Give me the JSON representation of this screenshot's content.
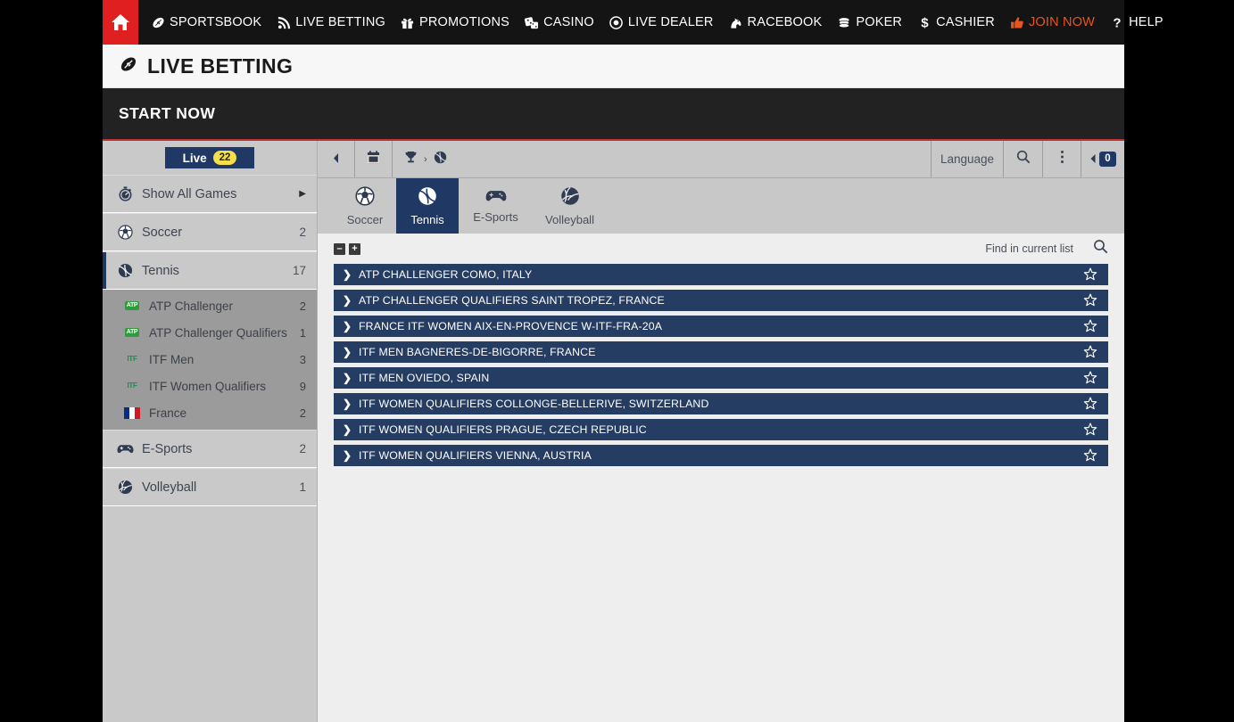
{
  "topnav": {
    "home_label": "Home",
    "items": [
      {
        "label": "SPORTSBOOK",
        "icon": "football-icon"
      },
      {
        "label": "LIVE BETTING",
        "icon": "signal-icon"
      },
      {
        "label": "PROMOTIONS",
        "icon": "gift-icon"
      },
      {
        "label": "CASINO",
        "icon": "dice-icon"
      },
      {
        "label": "LIVE DEALER",
        "icon": "target-icon"
      },
      {
        "label": "RACEBOOK",
        "icon": "horse-icon"
      },
      {
        "label": "POKER",
        "icon": "chips-icon"
      },
      {
        "label": "CASHIER",
        "icon": "dollar-icon"
      },
      {
        "label": "JOIN NOW",
        "icon": "thumbs-up-icon",
        "accent": "#e8541f"
      },
      {
        "label": "HELP",
        "icon": "question-icon"
      }
    ]
  },
  "page_header": {
    "title": "LIVE BETTING",
    "icon": "football-icon",
    "section_title": "START NOW"
  },
  "sidebar": {
    "live_label": "Live",
    "live_count": "22",
    "show_all": {
      "label": "Show All Games",
      "icon": "stopwatch-icon"
    },
    "sports": [
      {
        "label": "Soccer",
        "count": "2",
        "icon": "soccer-ball-icon",
        "active": false
      },
      {
        "label": "Tennis",
        "count": "17",
        "icon": "tennis-ball-icon",
        "active": true
      },
      {
        "label": "E-Sports",
        "count": "2",
        "icon": "gamepad-icon",
        "active": false
      },
      {
        "label": "Volleyball",
        "count": "1",
        "icon": "volleyball-icon",
        "active": false
      }
    ],
    "tennis_leagues": [
      {
        "label": "ATP Challenger",
        "count": "2",
        "icon": "atp-badge-icon"
      },
      {
        "label": "ATP Challenger Qualifiers",
        "count": "1",
        "icon": "atp-badge-icon"
      },
      {
        "label": "ITF Men",
        "count": "3",
        "icon": "itf-badge-icon"
      },
      {
        "label": "ITF Women Qualifiers",
        "count": "9",
        "icon": "itf-badge-icon"
      },
      {
        "label": "France",
        "count": "2",
        "icon": "france-flag-icon"
      }
    ]
  },
  "toolbar": {
    "back_icon": "caret-left-icon",
    "calendar_icon": "calendar-icon",
    "crumb_trophy_icon": "trophy-icon",
    "crumb_separator": "›",
    "crumb_sport_icon": "tennis-ball-icon",
    "language_label": "Language",
    "search_icon": "search-icon",
    "more_icon": "kebab-menu-icon",
    "betslip_icon": "caret-left-icon",
    "betslip_count": "0"
  },
  "sport_tabs": [
    {
      "label": "Soccer",
      "icon": "soccer-ball-icon",
      "active": false
    },
    {
      "label": "Tennis",
      "icon": "tennis-ball-icon",
      "active": true
    },
    {
      "label": "E-Sports",
      "icon": "gamepad-icon",
      "active": false
    },
    {
      "label": "Volleyball",
      "icon": "volleyball-icon",
      "active": false
    }
  ],
  "list_toolbar": {
    "collapse_all_label": "–",
    "expand_all_label": "+",
    "find_label": "Find in current list",
    "find_icon": "search-icon"
  },
  "tournaments": [
    {
      "name": "ATP CHALLENGER COMO, ITALY",
      "expand_icon": "chevron-right-icon",
      "favorite_icon": "star-outline-icon"
    },
    {
      "name": "ATP CHALLENGER QUALIFIERS SAINT TROPEZ, FRANCE",
      "expand_icon": "chevron-right-icon",
      "favorite_icon": "star-outline-icon"
    },
    {
      "name": "FRANCE ITF WOMEN AIX-EN-PROVENCE W-ITF-FRA-20A",
      "expand_icon": "chevron-right-icon",
      "favorite_icon": "star-outline-icon"
    },
    {
      "name": "ITF MEN BAGNERES-DE-BIGORRE, FRANCE",
      "expand_icon": "chevron-right-icon",
      "favorite_icon": "star-outline-icon"
    },
    {
      "name": "ITF MEN OVIEDO, SPAIN",
      "expand_icon": "chevron-right-icon",
      "favorite_icon": "star-outline-icon"
    },
    {
      "name": "ITF WOMEN QUALIFIERS COLLONGE-BELLERIVE, SWITZERLAND",
      "expand_icon": "chevron-right-icon",
      "favorite_icon": "star-outline-icon"
    },
    {
      "name": "ITF WOMEN QUALIFIERS PRAGUE, CZECH REPUBLIC",
      "expand_icon": "chevron-right-icon",
      "favorite_icon": "star-outline-icon"
    },
    {
      "name": "ITF WOMEN QUALIFIERS VIENNA, AUSTRIA",
      "expand_icon": "chevron-right-icon",
      "favorite_icon": "star-outline-icon"
    }
  ],
  "colors": {
    "accent_red": "#e02020",
    "navy": "#1f3864",
    "row_navy": "#253c63",
    "join_orange": "#e8541f",
    "badge_yellow": "#f6df4c"
  }
}
